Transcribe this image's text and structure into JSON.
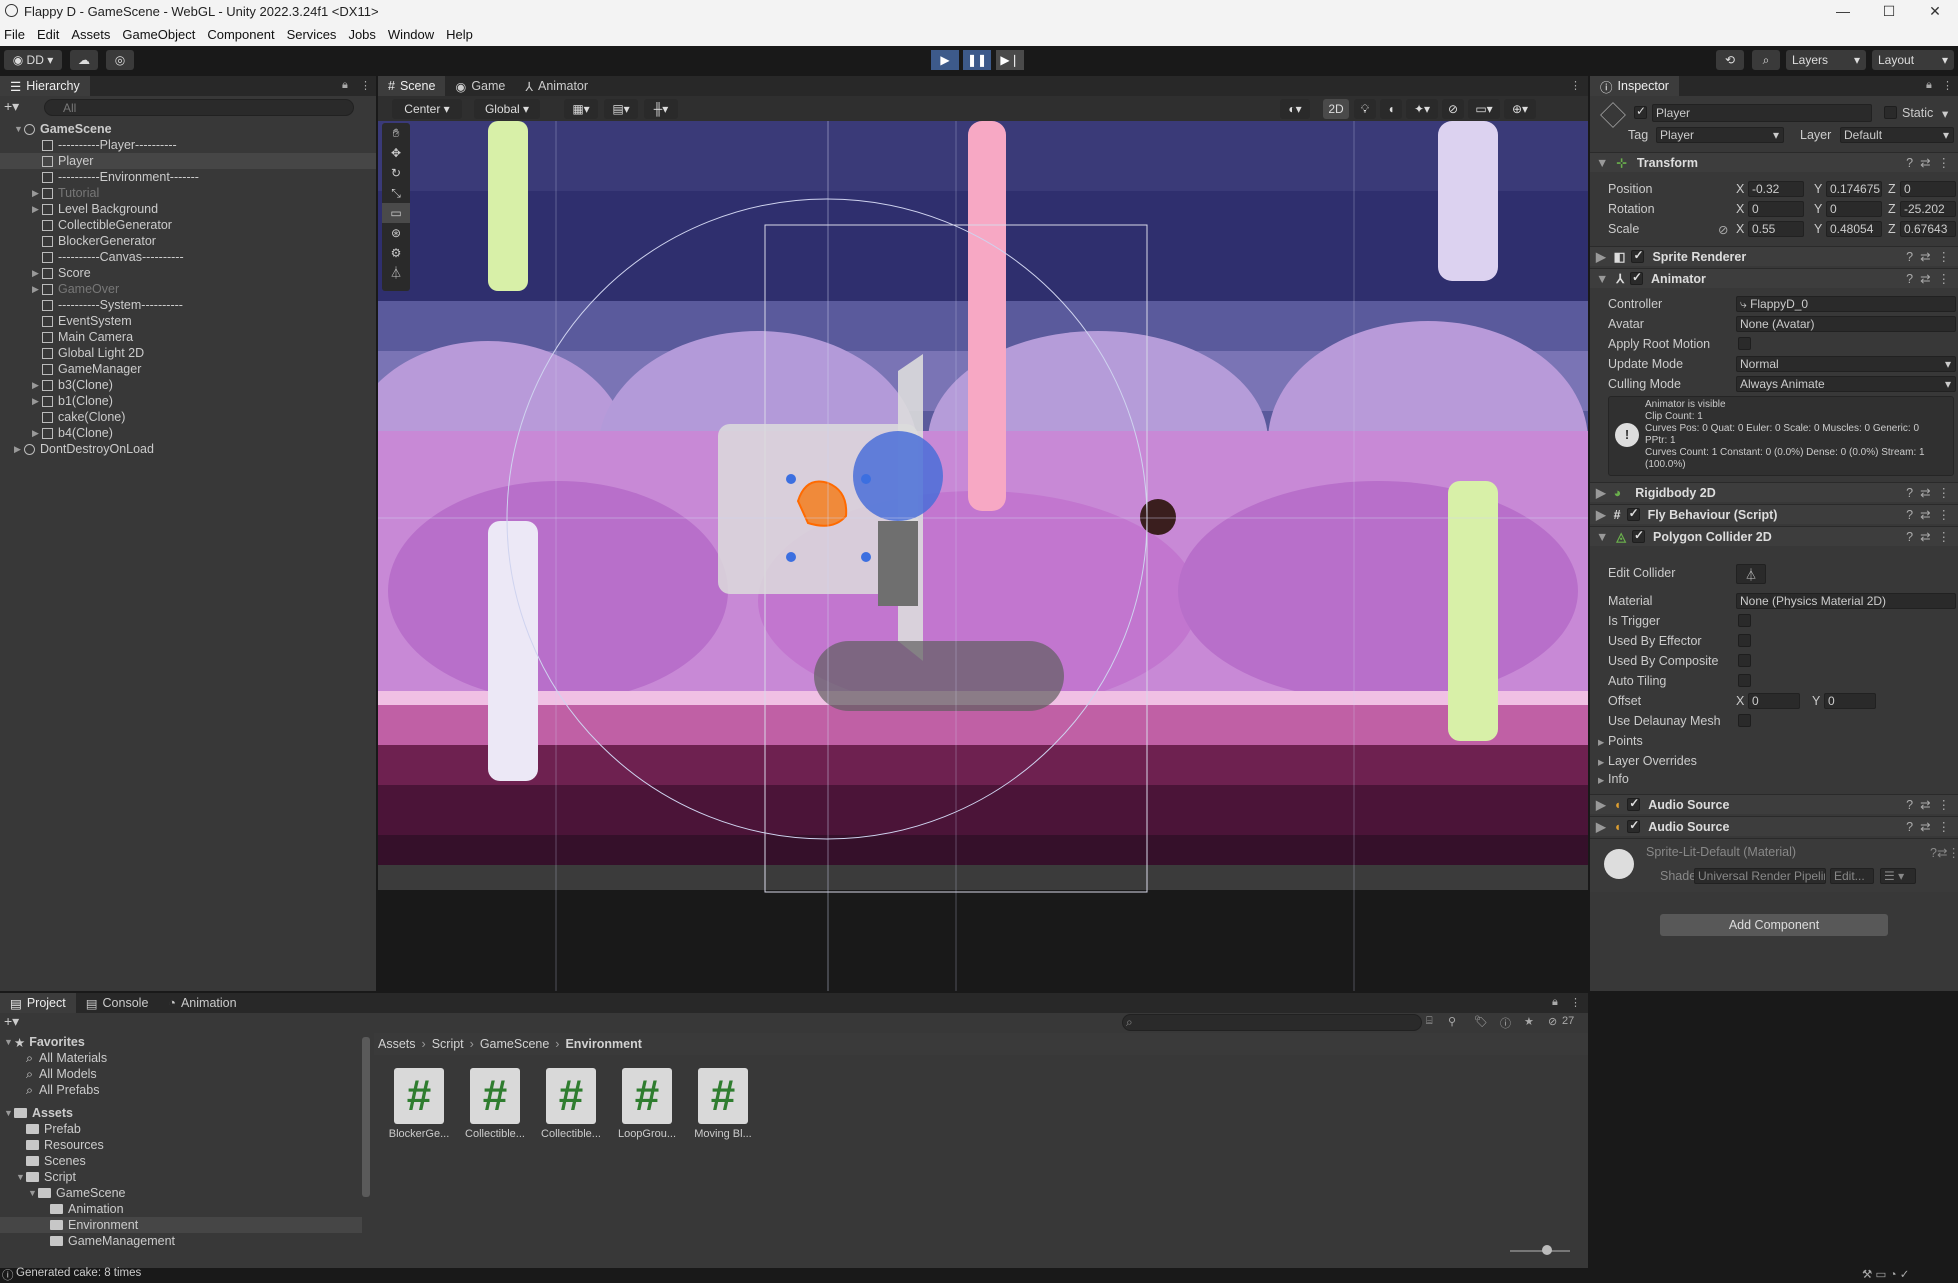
{
  "window": {
    "title": "Flappy D - GameScene - WebGL - Unity 2022.3.24f1 <DX11>",
    "controls": [
      "—",
      "☐",
      "✕"
    ]
  },
  "menu": [
    "File",
    "Edit",
    "Assets",
    "GameObject",
    "Component",
    "Services",
    "Jobs",
    "Window",
    "Help"
  ],
  "toolbar": {
    "account": "DD",
    "layers": "Layers",
    "layout": "Layout"
  },
  "hierarchy": {
    "tab": "Hierarchy",
    "search_placeholder": "All",
    "items": [
      {
        "label": "GameScene",
        "indent": 0,
        "expanded": true
      },
      {
        "label": "----------Player----------",
        "indent": 1
      },
      {
        "label": "Player",
        "indent": 1,
        "selected": true
      },
      {
        "label": "----------Environment-------",
        "indent": 1
      },
      {
        "label": "Tutorial",
        "indent": 1,
        "dim": true,
        "arrow": true
      },
      {
        "label": "Level Background",
        "indent": 1,
        "arrow": true
      },
      {
        "label": "CollectibleGenerator",
        "indent": 1
      },
      {
        "label": "BlockerGenerator",
        "indent": 1
      },
      {
        "label": "----------Canvas----------",
        "indent": 1
      },
      {
        "label": "Score",
        "indent": 1,
        "arrow": true
      },
      {
        "label": "GameOver",
        "indent": 1,
        "dim": true,
        "arrow": true
      },
      {
        "label": "----------System----------",
        "indent": 1
      },
      {
        "label": "EventSystem",
        "indent": 1
      },
      {
        "label": "Main Camera",
        "indent": 1
      },
      {
        "label": "Global Light 2D",
        "indent": 1
      },
      {
        "label": "GameManager",
        "indent": 1
      },
      {
        "label": "b3(Clone)",
        "indent": 1,
        "arrow": true
      },
      {
        "label": "b1(Clone)",
        "indent": 1,
        "arrow": true
      },
      {
        "label": "cake(Clone)",
        "indent": 1
      },
      {
        "label": "b4(Clone)",
        "indent": 1,
        "arrow": true
      },
      {
        "label": "DontDestroyOnLoad",
        "indent": 0,
        "arrow": true
      }
    ]
  },
  "scene": {
    "tabs": [
      "Scene",
      "Game",
      "Animator"
    ],
    "pivot": "Center",
    "space": "Global",
    "mode2d": "2D"
  },
  "inspector": {
    "tab": "Inspector",
    "object_name": "Player",
    "static_label": "Static",
    "tag_label": "Tag",
    "tag_value": "Player",
    "layer_label": "Layer",
    "layer_value": "Default",
    "transform": {
      "title": "Transform",
      "position_label": "Position",
      "position": {
        "x": "-0.32",
        "y": "0.174675",
        "z": "0"
      },
      "rotation_label": "Rotation",
      "rotation": {
        "x": "0",
        "y": "0",
        "z": "-25.202"
      },
      "scale_label": "Scale",
      "scale": {
        "x": "0.55",
        "y": "0.48054",
        "z": "0.67643"
      }
    },
    "sprite_renderer": "Sprite Renderer",
    "animator": {
      "title": "Animator",
      "controller_label": "Controller",
      "controller": "FlappyD_0",
      "avatar_label": "Avatar",
      "avatar": "None (Avatar)",
      "apply_root_label": "Apply Root Motion",
      "update_mode_label": "Update Mode",
      "update_mode": "Normal",
      "culling_label": "Culling Mode",
      "culling": "Always Animate",
      "info": [
        "Animator is visible",
        "Clip Count: 1",
        "Curves Pos: 0 Quat: 0 Euler: 0 Scale: 0 Muscles: 0 Generic: 0",
        "PPtr: 1",
        "Curves Count: 1 Constant: 0 (0.0%) Dense: 0 (0.0%) Stream: 1",
        "(100.0%)"
      ]
    },
    "rigidbody": "Rigidbody 2D",
    "fly": "Fly Behaviour (Script)",
    "polygon": {
      "title": "Polygon Collider 2D",
      "edit_collider": "Edit Collider",
      "material_label": "Material",
      "material": "None (Physics Material 2D)",
      "is_trigger": "Is Trigger",
      "used_effector": "Used By Effector",
      "used_composite": "Used By Composite",
      "auto_tiling": "Auto Tiling",
      "offset_label": "Offset",
      "offset": {
        "x": "0",
        "y": "0"
      },
      "delaunay": "Use Delaunay Mesh",
      "points": "Points",
      "layer_overrides": "Layer Overrides",
      "info": "Info"
    },
    "audio1": "Audio Source",
    "audio2": "Audio Source",
    "material_name": "Sprite-Lit-Default (Material)",
    "shader_label": "Shader",
    "shader": "Universal Render Pipeline/",
    "shader_edit": "Edit...",
    "add_component": "Add Component"
  },
  "project": {
    "tabs": [
      "Project",
      "Console",
      "Animation"
    ],
    "favorites_label": "Favorites",
    "favorites": [
      "All Materials",
      "All Models",
      "All Prefabs"
    ],
    "assets_label": "Assets",
    "tree": [
      {
        "label": "Prefab",
        "indent": 1
      },
      {
        "label": "Resources",
        "indent": 1
      },
      {
        "label": "Scenes",
        "indent": 1
      },
      {
        "label": "Script",
        "indent": 1,
        "open": true
      },
      {
        "label": "GameScene",
        "indent": 2,
        "open": true
      },
      {
        "label": "Animation",
        "indent": 3
      },
      {
        "label": "Environment",
        "indent": 3,
        "selected": true
      },
      {
        "label": "GameManagement",
        "indent": 3
      }
    ],
    "breadcrumb": [
      "Assets",
      "Script",
      "GameScene",
      "Environment"
    ],
    "assets": [
      "BlockerGe...",
      "Collectible...",
      "Collectible...",
      "LoopGrou...",
      "Moving Bl..."
    ],
    "count": "27"
  },
  "status": "Generated cake: 8 times"
}
